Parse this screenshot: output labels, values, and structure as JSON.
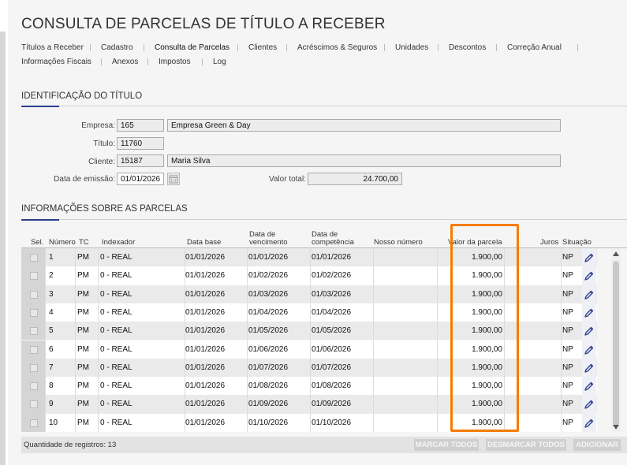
{
  "title": "CONSULTA DE PARCELAS DE TÍTULO A RECEBER",
  "tabs": {
    "row1": [
      "Títulos a Receber",
      "Cadastro",
      "Consulta de Parcelas",
      "Clientes",
      "Acréscimos & Seguros",
      "Unidades",
      "Descontos",
      "Correção Anual"
    ],
    "row2": [
      "Informações Fiscais",
      "Anexos",
      "Impostos",
      "Log"
    ],
    "active": "Consulta de Parcelas"
  },
  "identificacao": {
    "section_title": "IDENTIFICAÇÃO DO TÍTULO",
    "empresa_label": "Empresa:",
    "empresa_code": "165",
    "empresa_name": "Empresa Green & Day",
    "titulo_label": "Título:",
    "titulo_value": "11760",
    "cliente_label": "Cliente:",
    "cliente_code": "15187",
    "cliente_name": "Maria Silva",
    "data_emissao_label": "Data de emissão:",
    "data_emissao_value": "01/01/2026",
    "valor_total_label": "Valor total:",
    "valor_total_value": "24.700,00"
  },
  "parcelas": {
    "section_title": "INFORMAÇÕES SOBRE AS PARCELAS",
    "columns": {
      "sel": "Sel.",
      "numero": "Número",
      "tc": "TC",
      "indexador": "Indexador",
      "data_base": "Data base",
      "data_vencimento": "Data de vencimento",
      "data_competencia": "Data de competência",
      "nosso_numero": "Nosso número",
      "valor_parcela": "Valor da parcela",
      "juros": "Juros",
      "situacao": "Situação"
    },
    "rows": [
      {
        "numero": "1",
        "tc": "PM",
        "indexador": "0 - REAL",
        "data_base": "01/01/2026",
        "vencimento": "01/01/2026",
        "competencia": "01/01/2026",
        "valor": "1.900,00",
        "situacao": "NP"
      },
      {
        "numero": "2",
        "tc": "PM",
        "indexador": "0 - REAL",
        "data_base": "01/01/2026",
        "vencimento": "01/02/2026",
        "competencia": "01/02/2026",
        "valor": "1.900,00",
        "situacao": "NP"
      },
      {
        "numero": "3",
        "tc": "PM",
        "indexador": "0 - REAL",
        "data_base": "01/01/2026",
        "vencimento": "01/03/2026",
        "competencia": "01/03/2026",
        "valor": "1.900,00",
        "situacao": "NP"
      },
      {
        "numero": "4",
        "tc": "PM",
        "indexador": "0 - REAL",
        "data_base": "01/01/2026",
        "vencimento": "01/04/2026",
        "competencia": "01/04/2026",
        "valor": "1.900,00",
        "situacao": "NP"
      },
      {
        "numero": "5",
        "tc": "PM",
        "indexador": "0 - REAL",
        "data_base": "01/01/2026",
        "vencimento": "01/05/2026",
        "competencia": "01/05/2026",
        "valor": "1.900,00",
        "situacao": "NP"
      },
      {
        "numero": "6",
        "tc": "PM",
        "indexador": "0 - REAL",
        "data_base": "01/01/2026",
        "vencimento": "01/06/2026",
        "competencia": "01/06/2026",
        "valor": "1.900,00",
        "situacao": "NP"
      },
      {
        "numero": "7",
        "tc": "PM",
        "indexador": "0 - REAL",
        "data_base": "01/01/2026",
        "vencimento": "01/07/2026",
        "competencia": "01/07/2026",
        "valor": "1.900,00",
        "situacao": "NP"
      },
      {
        "numero": "8",
        "tc": "PM",
        "indexador": "0 - REAL",
        "data_base": "01/01/2026",
        "vencimento": "01/08/2026",
        "competencia": "01/08/2026",
        "valor": "1.900,00",
        "situacao": "NP"
      },
      {
        "numero": "9",
        "tc": "PM",
        "indexador": "0 - REAL",
        "data_base": "01/01/2026",
        "vencimento": "01/09/2026",
        "competencia": "01/09/2026",
        "valor": "1.900,00",
        "situacao": "NP"
      },
      {
        "numero": "10",
        "tc": "PM",
        "indexador": "0 - REAL",
        "data_base": "01/01/2026",
        "vencimento": "01/10/2026",
        "competencia": "01/10/2026",
        "valor": "1.900,00",
        "situacao": "NP"
      }
    ]
  },
  "footer": {
    "count_label": "Quantidade de registros: 13",
    "marcar_todos": "MARCAR TODOS",
    "desmarcar_todos": "DESMARCAR TODOS",
    "adicionar": "ADICIONAR"
  },
  "icons": {
    "edit": "pencil-icon",
    "calendar": "calendar-icon",
    "scroll_up": "chevron-up-icon",
    "scroll_down": "chevron-down-icon"
  },
  "colors": {
    "accent": "#2c3e8c",
    "highlight": "#f57c00",
    "edit_icon": "#2c3e8c"
  }
}
